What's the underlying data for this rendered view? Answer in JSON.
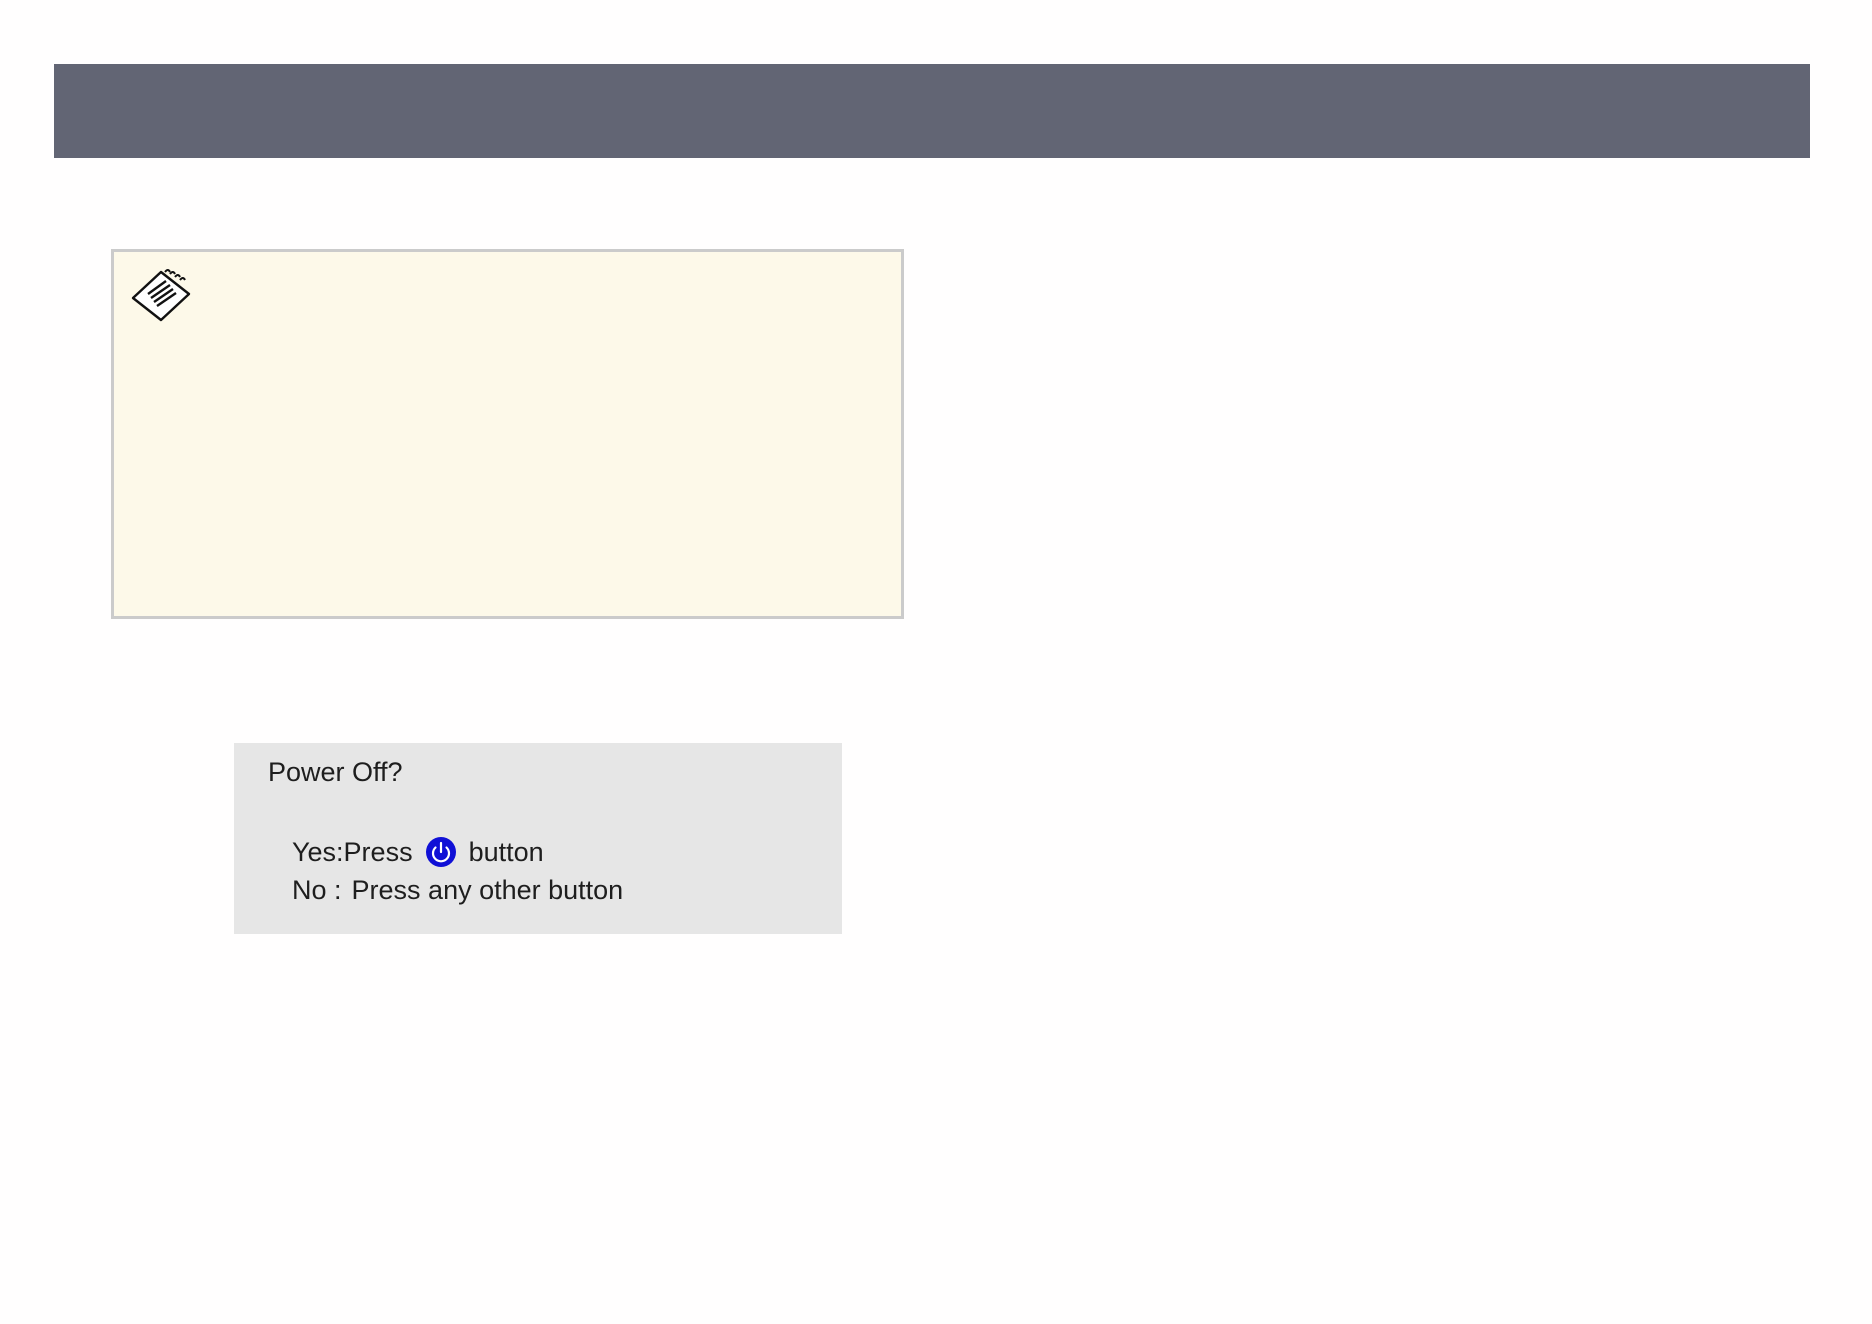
{
  "header": {
    "color": "#626574"
  },
  "note": {
    "icon": "notepad-icon",
    "background": "#fdf9e9"
  },
  "dialog": {
    "title": "Power Off?",
    "yes_prefix": "Yes:Press",
    "yes_icon": "power-icon",
    "yes_suffix": "button",
    "no_prefix": "No :",
    "no_text": "Press any other button",
    "icon_color": "#1010d6"
  }
}
